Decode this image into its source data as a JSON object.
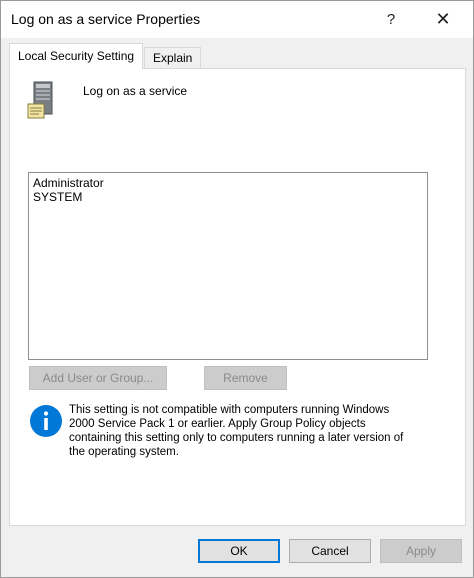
{
  "window": {
    "title": "Log on as a service Properties",
    "help_label": "?",
    "close_label": "✕"
  },
  "tabs": [
    {
      "label": "Local Security Setting",
      "active": true
    },
    {
      "label": "Explain",
      "active": false
    }
  ],
  "setting": {
    "icon": "server-icon",
    "policy_name": "Log on as a service"
  },
  "members": [
    "Administrator",
    "SYSTEM"
  ],
  "actions": {
    "add_label": "Add User or Group...",
    "remove_label": "Remove"
  },
  "info": {
    "icon": "info-icon",
    "color": "#0078d7",
    "text": "This setting is not compatible with computers running Windows 2000 Service Pack 1 or earlier.  Apply Group Policy objects containing this setting only to computers running a later version of the operating system."
  },
  "footer": {
    "ok_label": "OK",
    "cancel_label": "Cancel",
    "apply_label": "Apply"
  }
}
